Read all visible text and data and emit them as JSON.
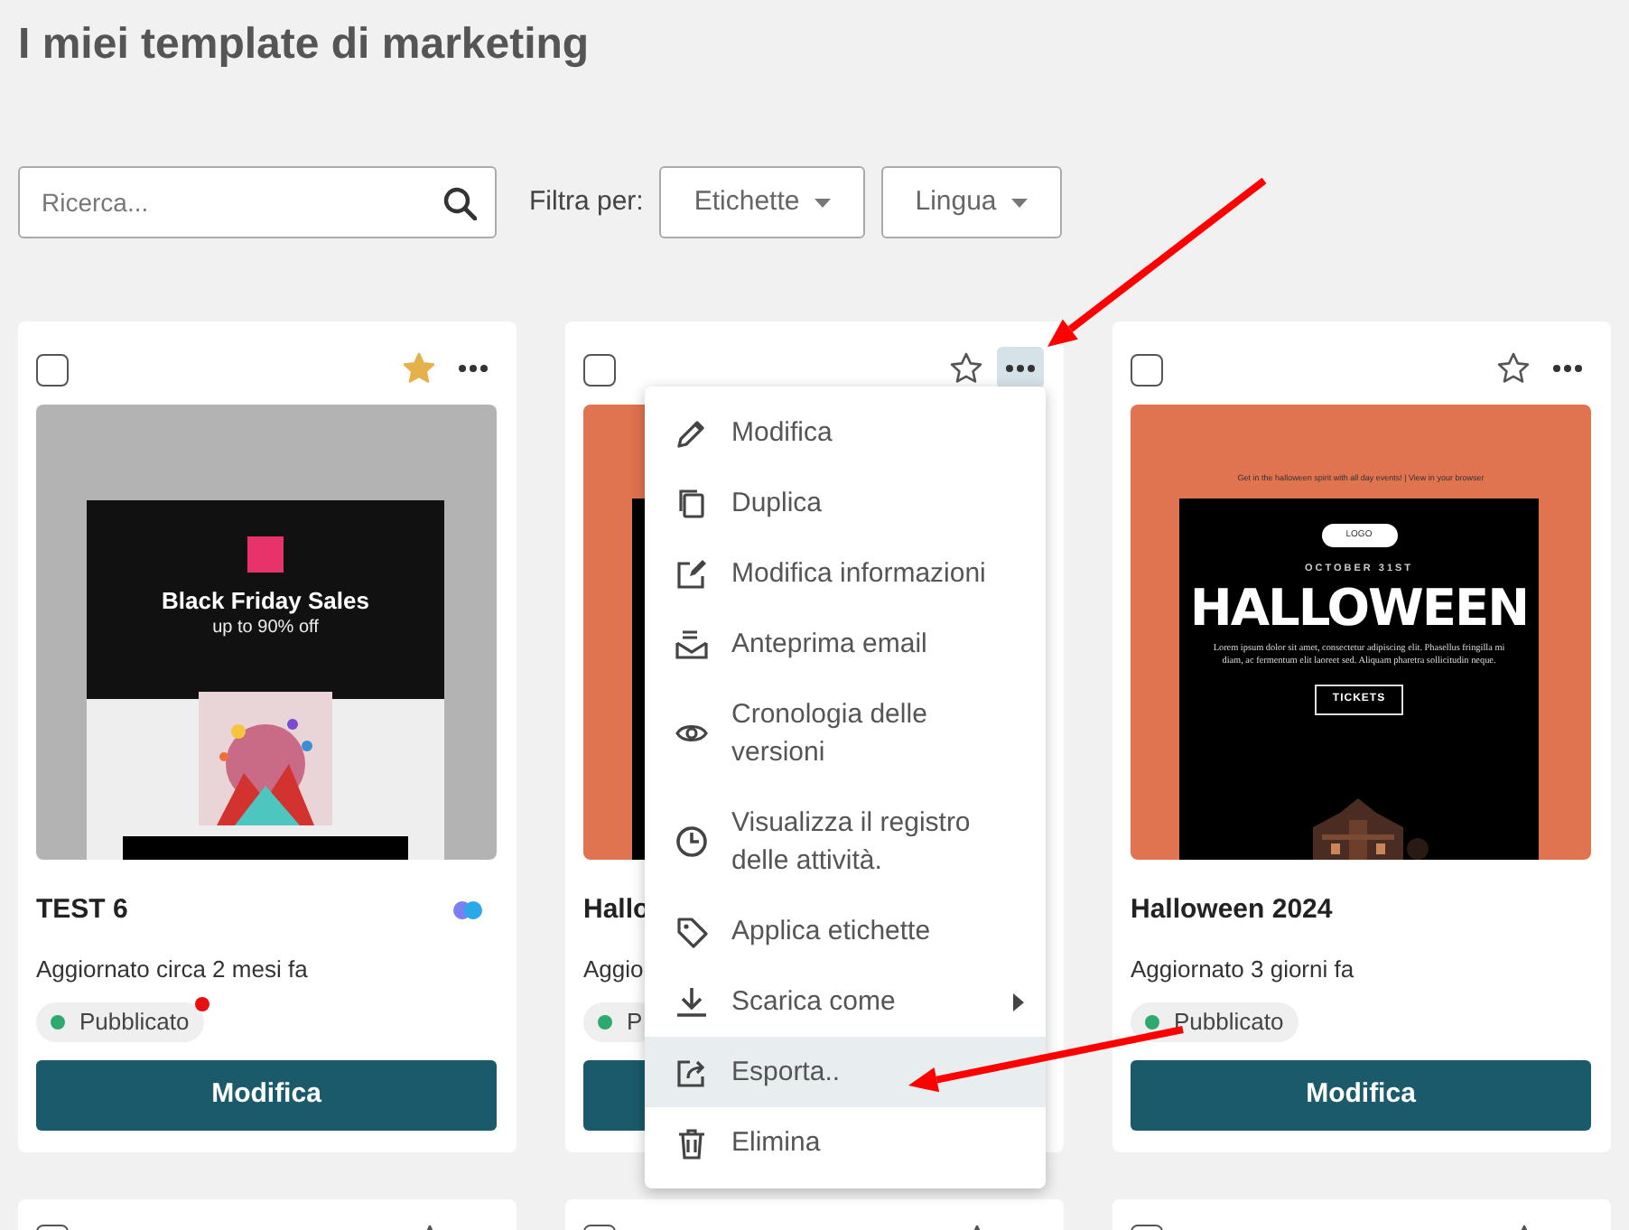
{
  "page_title": "I miei template di marketing",
  "search": {
    "placeholder": "Ricerca..."
  },
  "filter_label": "Filtra per:",
  "filters": [
    {
      "label": "Etichette"
    },
    {
      "label": "Lingua"
    }
  ],
  "cards": [
    {
      "checked": false,
      "starred": true,
      "menu_open": false,
      "title": "TEST 6",
      "shared": true,
      "updated": "Aggiornato circa 2 mesi fa",
      "status": "Pubblicato",
      "notification": true,
      "button": "Modifica",
      "preview": {
        "kind": "black-friday",
        "headline": "Black Friday Sales",
        "subline": "up to 90% off"
      }
    },
    {
      "checked": false,
      "starred": false,
      "menu_open": true,
      "title": "Hallo",
      "shared": false,
      "updated": "Aggio",
      "status": "P",
      "notification": false,
      "preview": {
        "kind": "halloween"
      }
    },
    {
      "checked": false,
      "starred": false,
      "menu_open": false,
      "title": "Halloween 2024",
      "shared": false,
      "updated": "Aggiornato 3 giorni fa",
      "status": "Pubblicato",
      "notification": false,
      "button": "Modifica",
      "preview": {
        "kind": "halloween",
        "top_note": "Get in the halloween spirit with all day events! | View in your browser",
        "logo": "LOGO",
        "date": "OCTOBER 31ST",
        "headline": "HALLOWEEN",
        "body": "Lorem ipsum dolor sit amet, consectetur adipiscing elit. Phasellus fringilla mi diam, ac fermentum elit laoreet sed. Aliquam pharetra sollicitudin neque.",
        "cta": "TICKETS"
      }
    }
  ],
  "context_menu": {
    "items": [
      {
        "label": "Modifica",
        "submenu": false,
        "highlighted": false
      },
      {
        "label": "Duplica",
        "submenu": false,
        "highlighted": false
      },
      {
        "label": "Modifica informazioni",
        "submenu": false,
        "highlighted": false
      },
      {
        "label": "Anteprima email",
        "submenu": false,
        "highlighted": false
      },
      {
        "label": "Cronologia delle versioni",
        "submenu": false,
        "highlighted": false
      },
      {
        "label": "Visualizza il registro delle attività.",
        "submenu": false,
        "highlighted": false
      },
      {
        "label": "Applica etichette",
        "submenu": false,
        "highlighted": false
      },
      {
        "label": "Scarica come",
        "submenu": true,
        "highlighted": false
      },
      {
        "label": "Esporta..",
        "submenu": false,
        "highlighted": true
      },
      {
        "label": "Elimina",
        "submenu": false,
        "highlighted": false
      }
    ]
  },
  "next_row": [
    {
      "checked": false,
      "starred": false
    },
    {
      "checked": false,
      "starred": false
    },
    {
      "checked": false,
      "starred": false
    }
  ],
  "annotations": [
    {
      "kind": "arrow"
    },
    {
      "kind": "arrow"
    }
  ]
}
